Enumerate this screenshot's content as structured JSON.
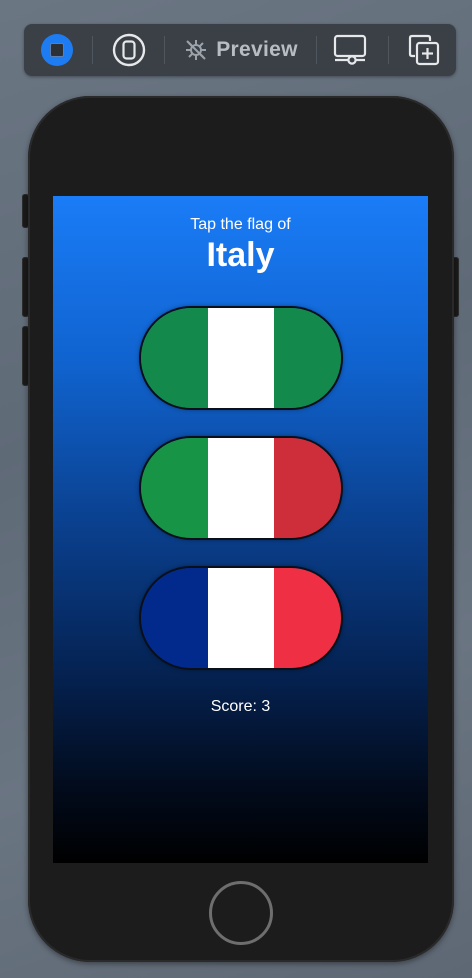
{
  "toolbar": {
    "preview_label": "Preview",
    "icons": [
      "live-preview-icon",
      "device-icon",
      "preview-pin-icon",
      "display-settings-icon",
      "duplicate-icon"
    ],
    "live_color": "#1e7cf2"
  },
  "game": {
    "prompt": "Tap the flag of",
    "country": "Italy",
    "flags": [
      {
        "name": "flag-option-1",
        "colors": [
          "#138a4c",
          "#ffffff",
          "#138a4c"
        ]
      },
      {
        "name": "flag-option-2",
        "colors": [
          "#179445",
          "#ffffff",
          "#cd2e3a"
        ]
      },
      {
        "name": "flag-option-3",
        "colors": [
          "#012a8c",
          "#ffffff",
          "#ee2f44"
        ]
      }
    ],
    "score_text": "Score: 3"
  },
  "colors": {
    "screen_top": "#1a7cf7",
    "screen_bottom": "#000000",
    "phone_body": "#1c1c1c"
  }
}
